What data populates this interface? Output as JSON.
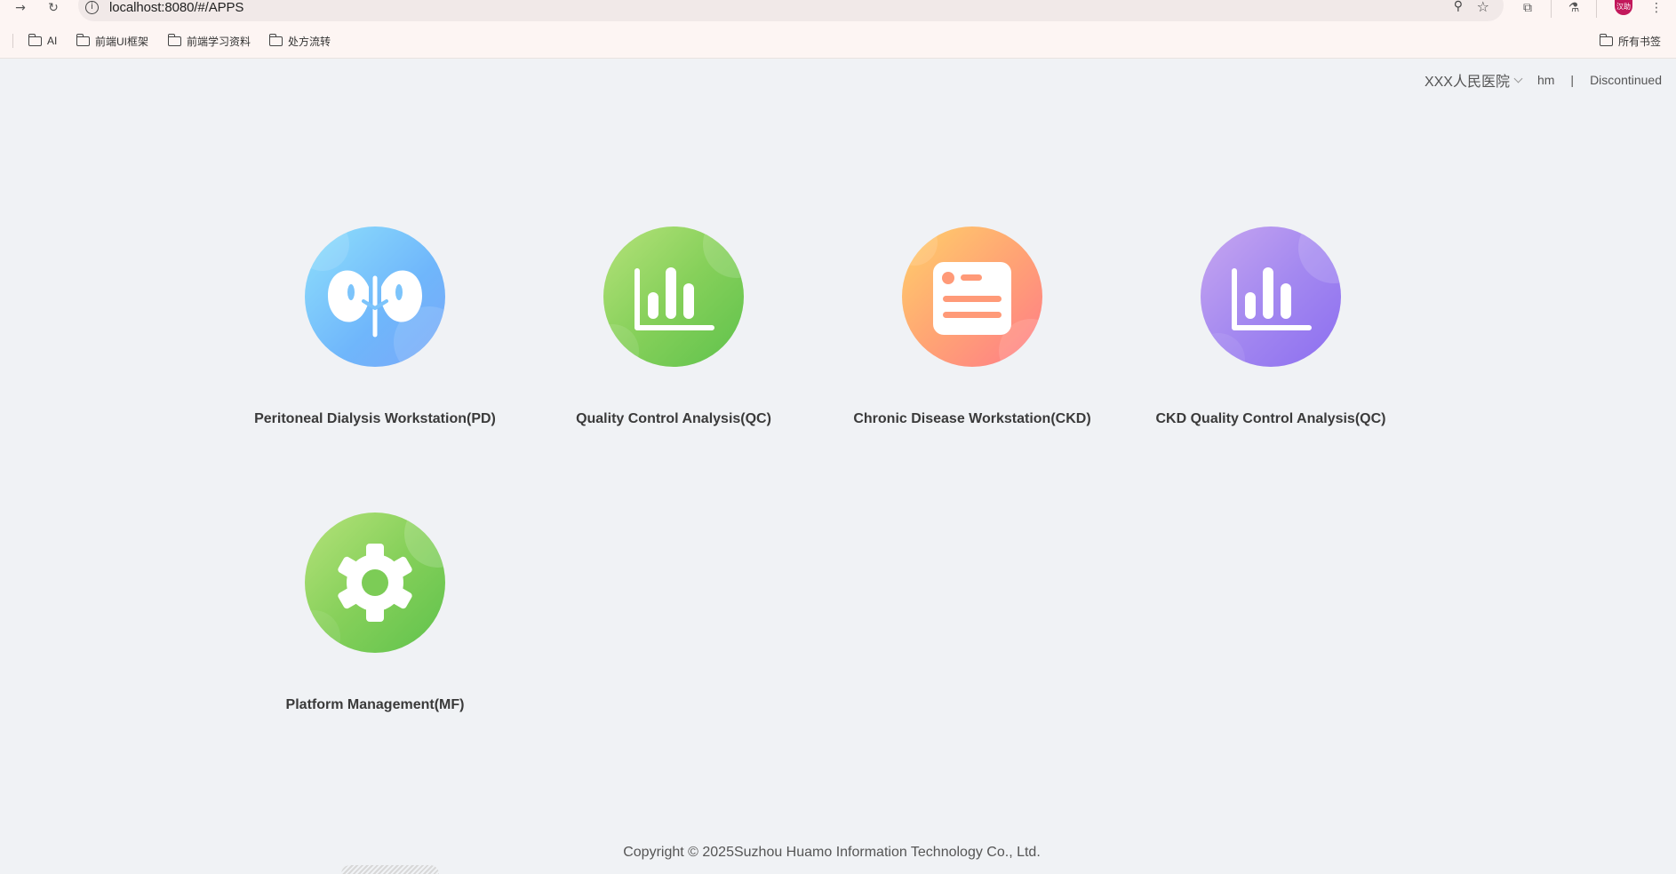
{
  "browser": {
    "url": "localhost:8080/#/APPS",
    "avatar_text": "汉助",
    "bookmarks": [
      {
        "label": "AI"
      },
      {
        "label": "前端UI框架"
      },
      {
        "label": "前端学习资料"
      },
      {
        "label": "处方流转"
      }
    ],
    "all_bookmarks_label": "所有书签"
  },
  "header": {
    "hospital": "XXX人民医院",
    "user": "hm",
    "separator": "|",
    "status": "Discontinued"
  },
  "apps": [
    {
      "label": "Peritoneal Dialysis Workstation(PD)",
      "icon": "kidney-icon",
      "color": "#6fb6fb"
    },
    {
      "label": "Quality Control Analysis(QC)",
      "icon": "bar-chart-icon",
      "color": "#86d05a"
    },
    {
      "label": "Chronic Disease Workstation(CKD)",
      "icon": "id-card-icon",
      "color": "#ff9a78"
    },
    {
      "label": "CKD Quality Control Analysis(QC)",
      "icon": "bar-chart-icon",
      "color": "#a489f0"
    },
    {
      "label": "Platform Management(MF)",
      "icon": "gear-icon",
      "color": "#86d05a"
    }
  ],
  "footer": {
    "copyright": "Copyright © 2025Suzhou Huamo Information Technology Co., Ltd."
  }
}
